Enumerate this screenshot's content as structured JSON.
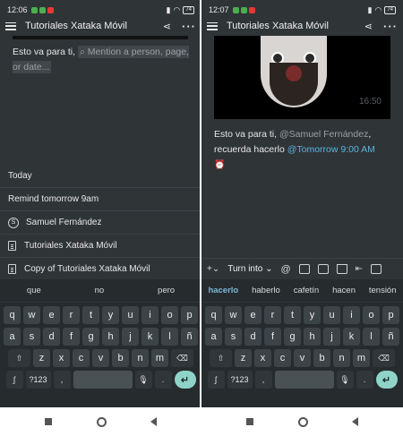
{
  "left": {
    "status": {
      "time": "12:06",
      "battery": "74"
    },
    "app_title": "Tutoriales Xataka Móvil",
    "editor_text": "Esto va para ti, ",
    "mention_placeholder": "Mention a person, page, or date...",
    "suggestions": [
      {
        "label": "Today"
      },
      {
        "label": "Remind tomorrow 9am"
      },
      {
        "label": "Samuel Fernández",
        "icon": "user-s-icon"
      },
      {
        "label": "Tutoriales Xataka Móvil",
        "icon": "page-icon"
      },
      {
        "label": "Copy of Tutoriales Xataka Móvil",
        "icon": "page-icon"
      }
    ],
    "word_suggestions": [
      "que",
      "no",
      "pero"
    ]
  },
  "right": {
    "status": {
      "time": "12:07",
      "battery": "74"
    },
    "app_title": "Tutoriales Xataka Móvil",
    "video_time": "16:50",
    "text_prefix": "Esto va para ti, ",
    "mention": "@Samuel Fernández",
    "text_mid": ", recuerda hacerlo ",
    "date": "@Tomorrow 9:00 AM",
    "toolbar": {
      "add": "+",
      "turn_into": "Turn into",
      "at": "@"
    },
    "word_suggestions": [
      "hacerlo",
      "haberlo",
      "cafetín",
      "hacen",
      "tensión"
    ]
  },
  "keyboard": {
    "row1": [
      "q",
      "w",
      "e",
      "r",
      "t",
      "y",
      "u",
      "i",
      "o",
      "p"
    ],
    "row2": [
      "a",
      "s",
      "d",
      "f",
      "g",
      "h",
      "j",
      "k",
      "l",
      "ñ"
    ],
    "row3": [
      "z",
      "x",
      "c",
      "v",
      "b",
      "n",
      "m"
    ],
    "numbers_key": "?123",
    "comma": ",",
    "period": "."
  },
  "colors": {
    "background": "#2f3437",
    "keyboard": "#262b2e",
    "link": "#5fb4dd",
    "enter": "#8fd3c8"
  }
}
